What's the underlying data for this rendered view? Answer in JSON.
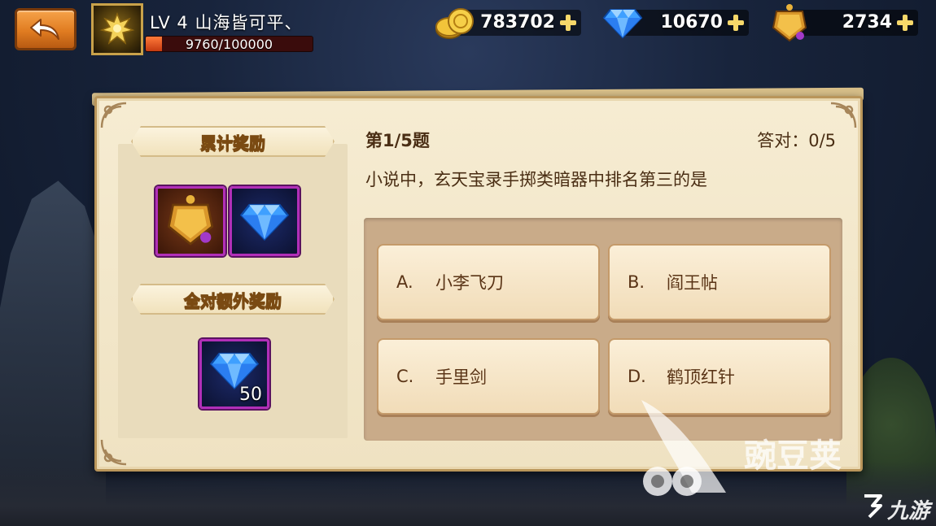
{
  "header": {
    "level_text": "LV 4  山海皆可平、",
    "exp_text": "9760/100000",
    "exp_fraction": 0.0976
  },
  "currencies": [
    {
      "name": "gold-coins",
      "amount": "783702"
    },
    {
      "name": "diamond",
      "amount": "10670"
    },
    {
      "name": "token",
      "amount": "2734"
    }
  ],
  "rewards": {
    "cumulative_title": "累计奖励",
    "bonus_title": "全对额外奖励",
    "bonus_count": "50"
  },
  "question": {
    "number": "第1/5题",
    "score": "答对：0/5",
    "text": "小说中，玄天宝录手掷类暗器中排名第三的是",
    "options": [
      {
        "letter": "A.",
        "text": "小李飞刀"
      },
      {
        "letter": "B.",
        "text": "阎王帖"
      },
      {
        "letter": "C.",
        "text": "手里剑"
      },
      {
        "letter": "D.",
        "text": "鹤顶红针"
      }
    ]
  },
  "watermark": {
    "main": "豌豆荚",
    "corner": "九游"
  },
  "colors": {
    "panel_bg": "#f6ecd2",
    "ribbon_text": "#f3ca52",
    "slot_border": "#b12fb8",
    "back_button": "#e07c21"
  }
}
